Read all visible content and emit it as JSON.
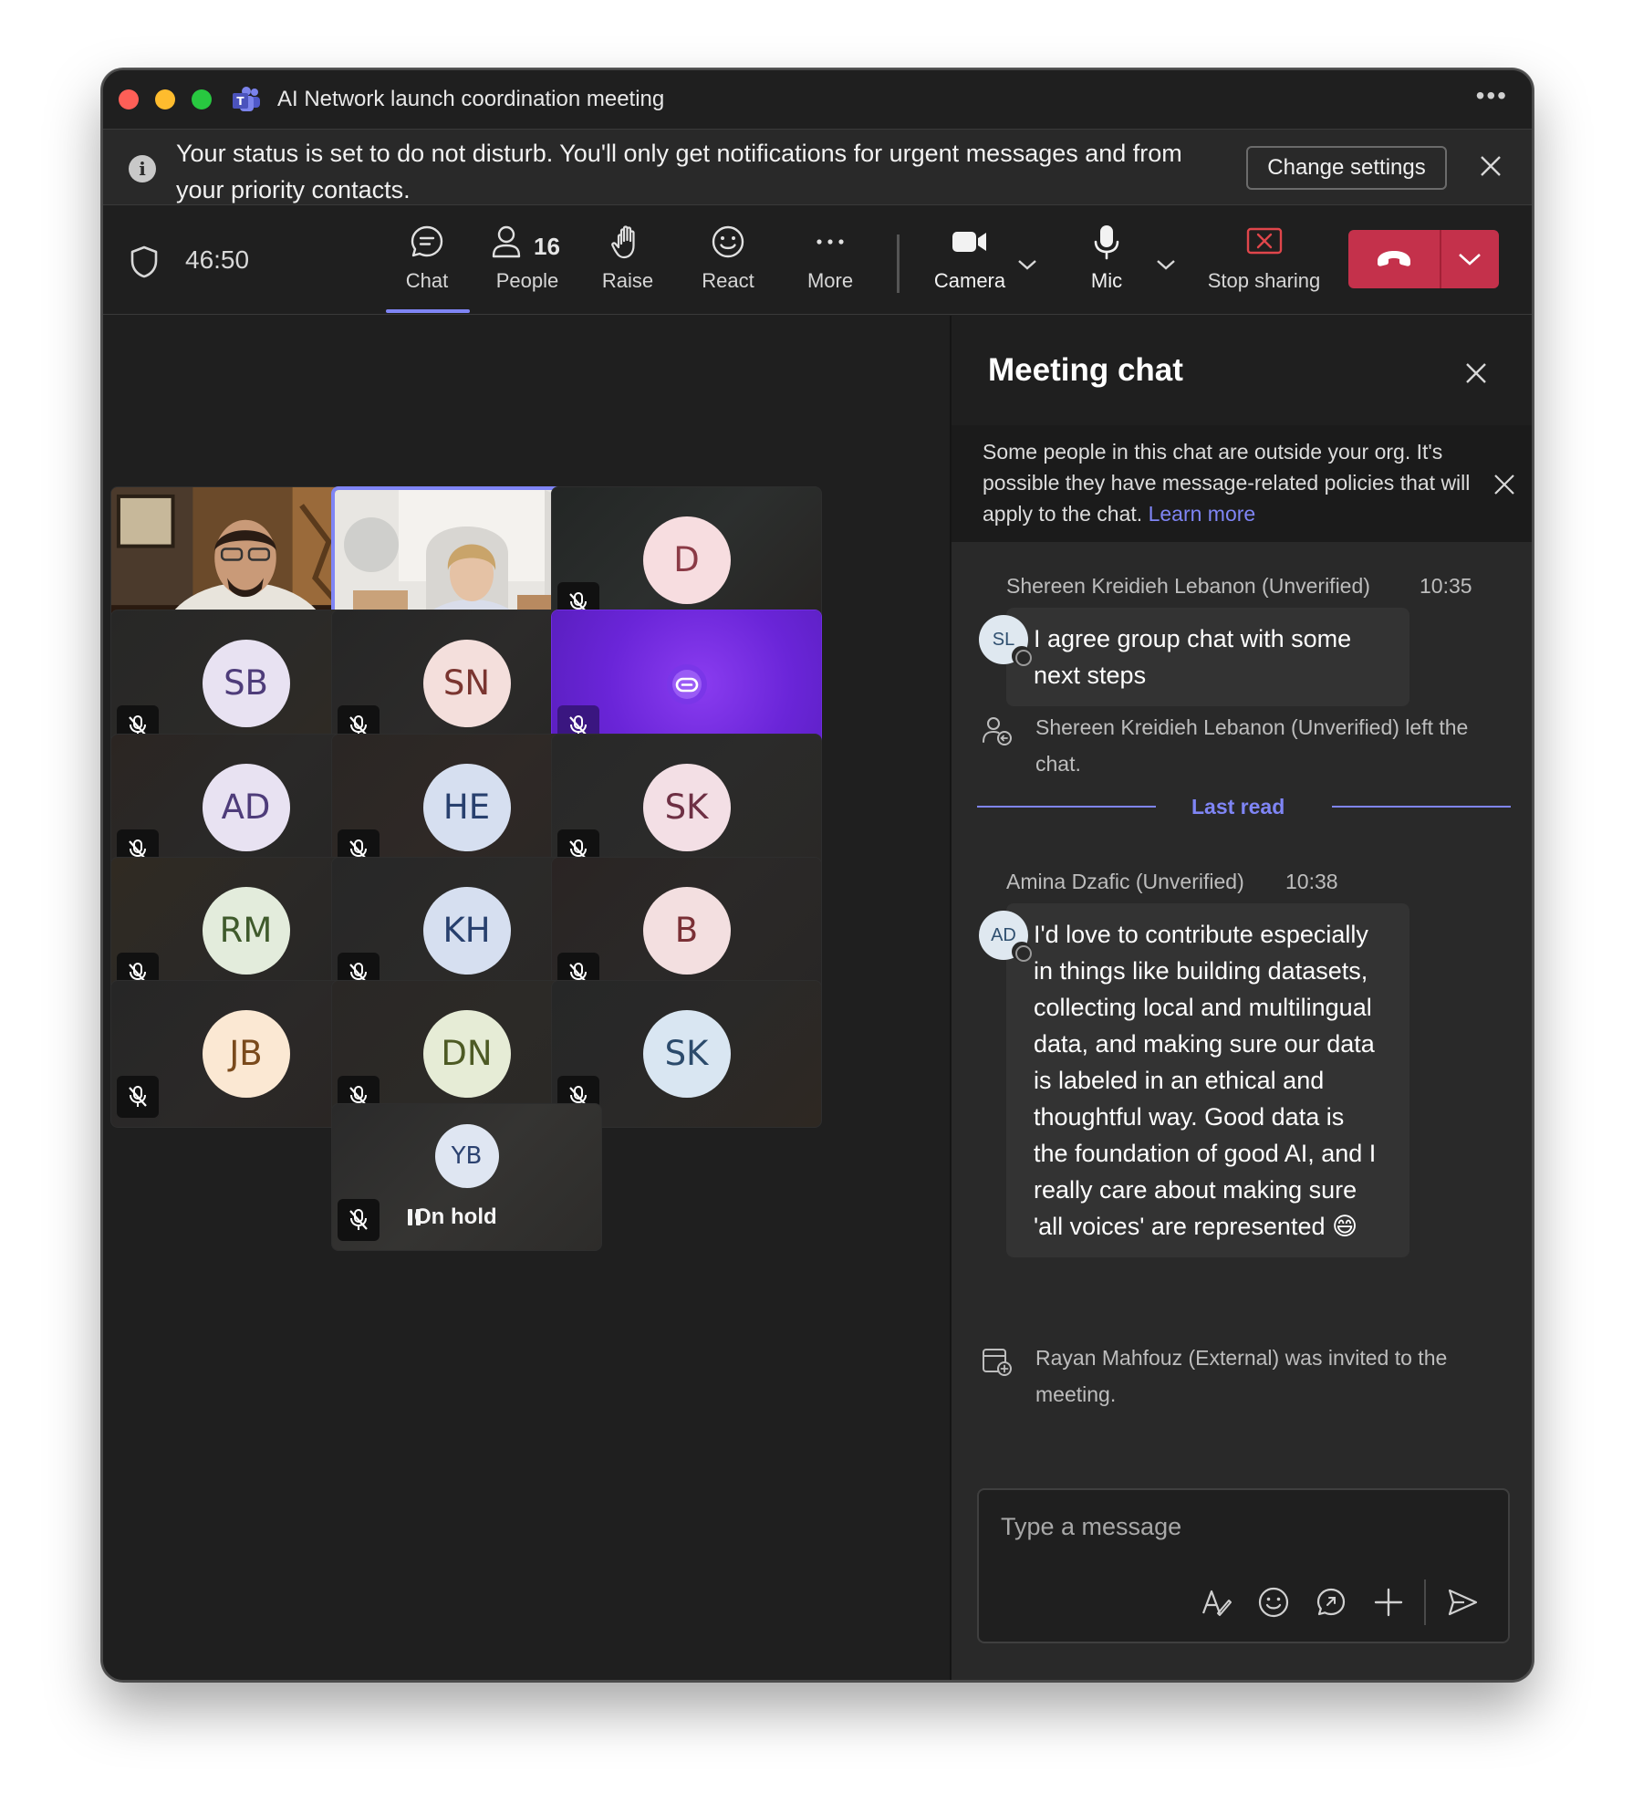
{
  "window": {
    "title": "AI Network launch coordination meeting"
  },
  "banner": {
    "text": "Your status is set to do not disturb. You'll only get notifications for urgent messages and from your priority contacts.",
    "button": "Change settings"
  },
  "toolbar": {
    "timer": "46:50",
    "chat": "Chat",
    "people": "People",
    "people_count": "16",
    "raise": "Raise",
    "react": "React",
    "more": "More",
    "camera": "Camera",
    "mic": "Mic",
    "stop_sharing": "Stop sharing"
  },
  "participants": [
    {
      "initials": "",
      "type": "video-man"
    },
    {
      "initials": "",
      "type": "video-woman",
      "active": true
    },
    {
      "initials": "D",
      "bg": "#f7dde0",
      "fg": "#8b3a46",
      "muted": true
    },
    {
      "initials": "SB",
      "bg": "#e8e2f2",
      "fg": "#4e3c7a",
      "muted": true
    },
    {
      "initials": "SN",
      "bg": "#f4dfdc",
      "fg": "#7a3530",
      "muted": true
    },
    {
      "initials": "",
      "type": "bot",
      "muted": true
    },
    {
      "initials": "AD",
      "bg": "#e8e2f2",
      "fg": "#4e3c7a",
      "muted": true
    },
    {
      "initials": "HE",
      "bg": "#d6dff0",
      "fg": "#28406e",
      "muted": true
    },
    {
      "initials": "SK",
      "bg": "#f3dfe5",
      "fg": "#6e3044",
      "muted": true
    },
    {
      "initials": "RM",
      "bg": "#e3ecdc",
      "fg": "#3f5a2c",
      "muted": true
    },
    {
      "initials": "KH",
      "bg": "#d6dff0",
      "fg": "#28406e",
      "muted": true
    },
    {
      "initials": "B",
      "bg": "#f3dfe0",
      "fg": "#7a3036",
      "muted": true
    },
    {
      "initials": "JB",
      "bg": "#fbe8d3",
      "fg": "#7a4a1c",
      "muted": true
    },
    {
      "initials": "DN",
      "bg": "#e6ecd6",
      "fg": "#4d5a24",
      "muted": true
    },
    {
      "initials": "SK",
      "bg": "#d9e6f2",
      "fg": "#2c4b6c",
      "muted": true
    },
    {
      "initials": "YB",
      "bg": "#dfe6f2",
      "fg": "#2c4270",
      "muted": true,
      "status": "On hold"
    }
  ],
  "chat": {
    "title": "Meeting chat",
    "external_notice": "Some people in this chat are outside your org. It's possible they have message-related policies that will apply to the chat.",
    "learn_more": "Learn more",
    "msg1": {
      "author": "Shereen Kreidieh Lebanon (Unverified)",
      "time": "10:35",
      "initials": "SL",
      "text": "I agree group chat with some next steps"
    },
    "sys1": "Shereen Kreidieh Lebanon (Unverified) left the chat.",
    "last_read": "Last read",
    "msg2": {
      "author": "Amina Dzafic (Unverified)",
      "time": "10:38",
      "initials": "AD",
      "text": "I'd love to contribute especially in things like building datasets, collecting local and multilingual data, and making sure our data is labeled in an ethical and thoughtful way. Good data is the foundation of good AI, and I really care about making sure 'all voices' are represented 😄"
    },
    "sys2": "Rayan Mahfouz (External) was invited to the meeting.",
    "composer_placeholder": "Type a message"
  },
  "colors": {
    "accent": "#7f85f5",
    "leave": "#c4314b",
    "bot_tile": "#6f2de0"
  }
}
